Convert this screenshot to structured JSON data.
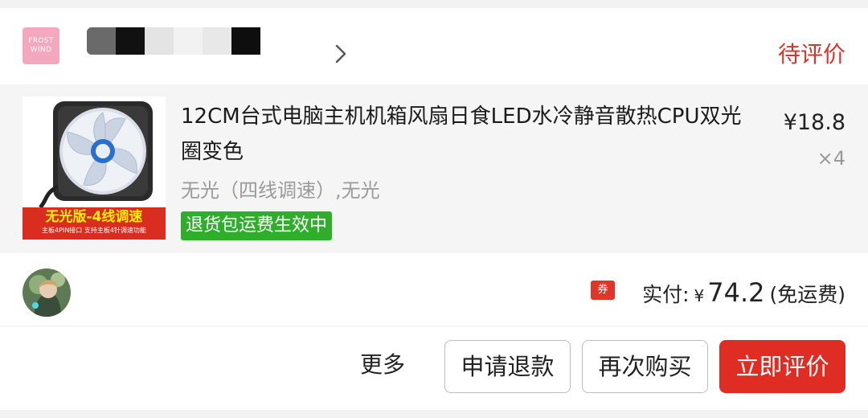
{
  "store": {
    "logo_text_line1": "FROST",
    "logo_text_line2": "WIND"
  },
  "order": {
    "status": "待评价"
  },
  "item": {
    "title": "12CM台式电脑主机机箱风扇日食LED水冷静音散热CPU双光圈变色",
    "sku": "无光（四线调速）,无光",
    "badge": "退货包运费生效中",
    "price": "¥18.8",
    "quantity": "×4",
    "thumbnail": {
      "banner_title": "无光版-4线调速",
      "banner_sub": "主板4PIN接口  支持主板4针调速功能"
    }
  },
  "payment": {
    "coupon_icon": "券",
    "label": "实付:",
    "currency": "¥",
    "amount": "74.2",
    "note": "(免运费)"
  },
  "actions": {
    "more": "更多",
    "refund": "申请退款",
    "rebuy": "再次购买",
    "review": "立即评价"
  },
  "colors": {
    "accent": "#e02d24",
    "status": "#d9342a",
    "badge": "#2fae2c"
  },
  "icons": {
    "chevron": "chevron-right-icon",
    "coupon": "coupon-icon",
    "fan": "fan-image"
  }
}
